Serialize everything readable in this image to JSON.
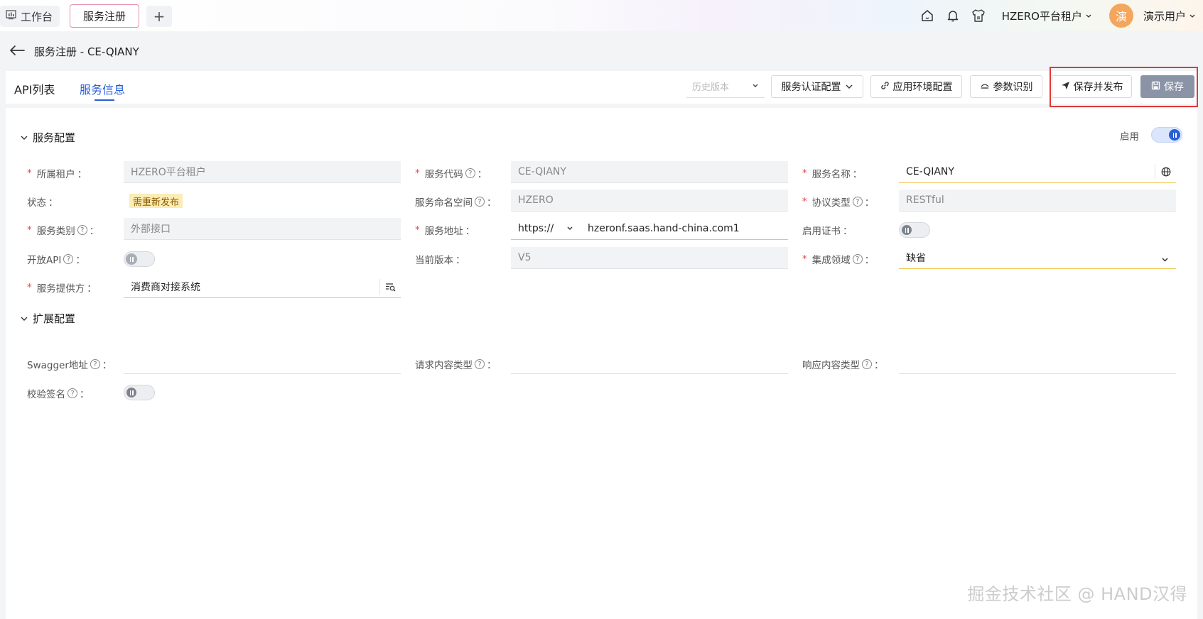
{
  "topbar": {
    "workbench_label": "工作台",
    "active_tab": "服务注册",
    "add_tab": "+",
    "tenant": "HZERO平台租户",
    "avatar_text": "演",
    "user_name": "演示用户"
  },
  "header": {
    "title": "服务注册 - CE-QIANY"
  },
  "tabs": [
    "API列表",
    "服务信息"
  ],
  "toolbar": {
    "history_placeholder": "历史版本",
    "auth_config": "服务认证配置",
    "env_config": "应用环境配置",
    "param_recognize": "参数识别",
    "save_publish": "保存并发布",
    "save": "保存"
  },
  "service_config": {
    "title": "服务配置",
    "enable_label": "启用",
    "enabled": true,
    "fields": {
      "tenant": {
        "label": "所属租户",
        "value": "HZERO平台租户"
      },
      "service_code": {
        "label": "服务代码",
        "value": "CE-QIANY"
      },
      "service_name": {
        "label": "服务名称",
        "value": "CE-QIANY"
      },
      "status": {
        "label": "状态",
        "value": "需重新发布"
      },
      "namespace": {
        "label": "服务命名空间",
        "value": "HZERO"
      },
      "protocol": {
        "label": "协议类型",
        "value": "RESTful"
      },
      "category": {
        "label": "服务类别",
        "value": "外部接口"
      },
      "address": {
        "label": "服务地址",
        "scheme": "https://",
        "value": "hzeronf.saas.hand-china.com1"
      },
      "cert": {
        "label": "启用证书",
        "enabled": false
      },
      "open_api": {
        "label": "开放API",
        "enabled": false
      },
      "version": {
        "label": "当前版本",
        "value": "V5"
      },
      "domain": {
        "label": "集成领域",
        "value": "缺省"
      },
      "provider": {
        "label": "服务提供方",
        "value": "消费商对接系统"
      }
    }
  },
  "ext_config": {
    "title": "扩展配置",
    "fields": {
      "swagger": {
        "label": "Swagger地址",
        "value": ""
      },
      "req_type": {
        "label": "请求内容类型",
        "value": ""
      },
      "resp_type": {
        "label": "响应内容类型",
        "value": ""
      },
      "sign_check": {
        "label": "校验签名",
        "enabled": false
      }
    }
  },
  "colon": "：",
  "watermark": "掘金技术社区 @ HAND汉得",
  "colors": {
    "primary": "#2a5fd6",
    "required": "#e5484d",
    "highlight": "#e03a3a"
  }
}
